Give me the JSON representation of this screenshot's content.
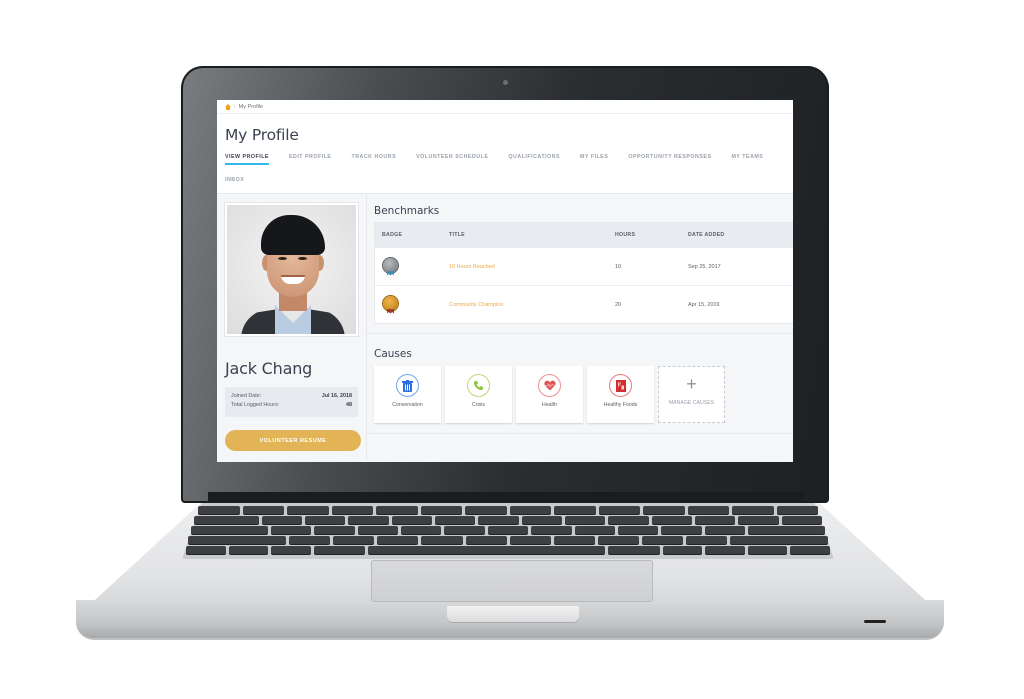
{
  "breadcrumb": {
    "home_icon": "home-icon",
    "current": "My Profile"
  },
  "header": {
    "title": "My Profile",
    "tabs": [
      {
        "label": "VIEW PROFILE",
        "active": true
      },
      {
        "label": "EDIT PROFILE",
        "active": false
      },
      {
        "label": "TRACK HOURS",
        "active": false
      },
      {
        "label": "VOLUNTEER SCHEDULE",
        "active": false
      },
      {
        "label": "QUALIFICATIONS",
        "active": false
      },
      {
        "label": "MY FILES",
        "active": false
      },
      {
        "label": "OPPORTUNITY RESPONSES",
        "active": false
      },
      {
        "label": "MY TEAMS",
        "active": false
      },
      {
        "label": "INBOX",
        "active": false
      }
    ]
  },
  "profile": {
    "name": "Jack Chang",
    "stats": [
      {
        "label": "Joined Date:",
        "value": "Jul 16, 2018"
      },
      {
        "label": "Total Logged Hours:",
        "value": "48"
      }
    ],
    "resume_button": "VOLUNTEER RESUME"
  },
  "benchmarks": {
    "title": "Benchmarks",
    "columns": [
      "BADGE",
      "TITLE",
      "HOURS",
      "DATE ADDED"
    ],
    "rows": [
      {
        "badge": "silver",
        "title": "10 Hours Reached",
        "hours": "10",
        "date": "Sep 25, 2017"
      },
      {
        "badge": "gold",
        "title": "Community Champion",
        "hours": "20",
        "date": "Apr 15, 2019"
      }
    ]
  },
  "causes": {
    "title": "Causes",
    "items": [
      {
        "label": "Conservation",
        "icon": "trash-bin-icon",
        "color": "#3b82f6"
      },
      {
        "label": "Crisis",
        "icon": "phone-icon",
        "color": "#8cc63f"
      },
      {
        "label": "Health",
        "icon": "heart-icon",
        "color": "#e05656"
      },
      {
        "label": "Healthy Foods",
        "icon": "food-label-icon",
        "color": "#d32f2f"
      }
    ],
    "manage_label": "MANAGE CAUSES"
  },
  "colors": {
    "accent": "#36b9e8",
    "button": "#e2b456",
    "link": "#e8a94e"
  }
}
